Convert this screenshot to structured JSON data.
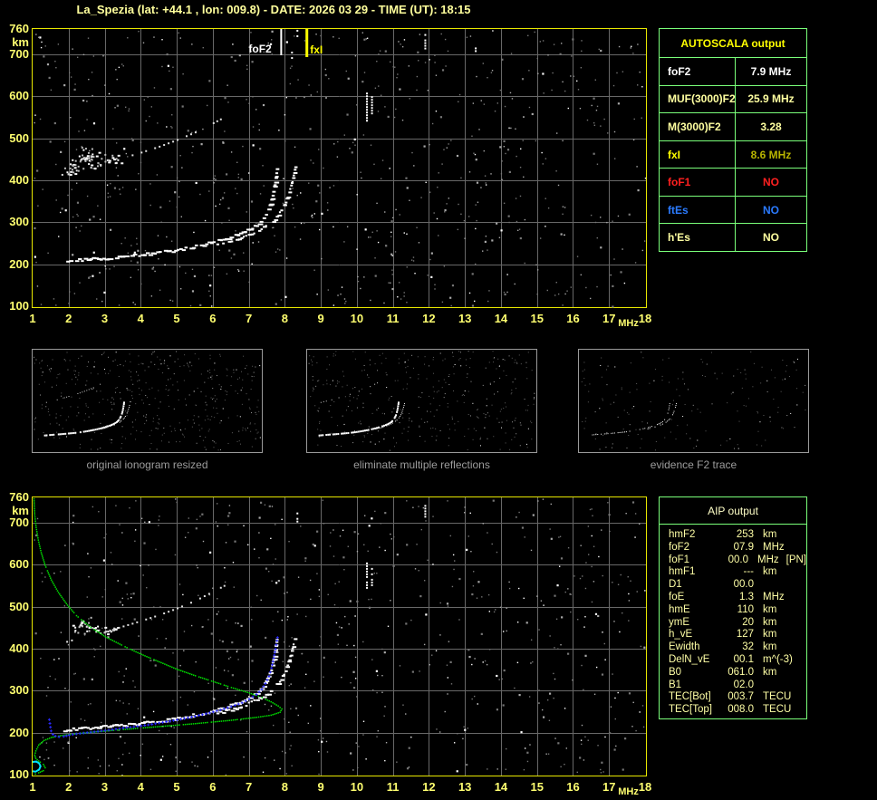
{
  "title": "La_Spezia (lat: +44.1 , lon: 009.8) - DATE: 2026 03 29 - TIME (UT): 18:15",
  "colors": {
    "title": "#ffff9c",
    "axis": "#ffff70",
    "grid": "#686868",
    "border": "#e8e800",
    "table_border": "#7aff7a",
    "trace": "#ffffff",
    "profile": "#00e400",
    "autoscaled": "#2a2aff",
    "e_region": "#00e5ff",
    "marker_foF2": "#ffffff",
    "marker_fxI": "#ffff00"
  },
  "autoscala": {
    "title": "AUTOSCALA output",
    "rows": [
      {
        "label": "foF2",
        "value": "7.9 MHz",
        "label_color": "#ffffff",
        "value_color": "#ffffff"
      },
      {
        "label": "MUF(3000)F2",
        "value": "25.9 MHz",
        "label_color": "#ffffa0",
        "value_color": "#ffffa0"
      },
      {
        "label": "M(3000)F2",
        "value": "3.28",
        "label_color": "#ffffa0",
        "value_color": "#ffffa0"
      },
      {
        "label": "fxI",
        "value": "8.6 MHz",
        "label_color": "#ffff00",
        "value_color": "#b8b400"
      },
      {
        "label": "foF1",
        "value": "NO",
        "label_color": "#ff2020",
        "value_color": "#ff2020"
      },
      {
        "label": "ftEs",
        "value": "NO",
        "label_color": "#2b7bff",
        "value_color": "#2b7bff"
      },
      {
        "label": "h'Es",
        "value": "NO",
        "label_color": "#ffffa0",
        "value_color": "#ffffa0"
      }
    ]
  },
  "aip": {
    "title": "AIP output",
    "rows": [
      {
        "label": "hmF2",
        "value": "253",
        "unit": "km",
        "note": ""
      },
      {
        "label": "foF2",
        "value": "07.9",
        "unit": "MHz",
        "note": ""
      },
      {
        "label": "foF1",
        "value": "00.0",
        "unit": "MHz",
        "note": "[PN]"
      },
      {
        "label": "hmF1",
        "value": "---",
        "unit": "km",
        "note": ""
      },
      {
        "label": "D1",
        "value": "00.0",
        "unit": "",
        "note": ""
      },
      {
        "label": "foE",
        "value": "1.3",
        "unit": "MHz",
        "note": ""
      },
      {
        "label": "hmE",
        "value": "110",
        "unit": "km",
        "note": ""
      },
      {
        "label": "ymE",
        "value": "20",
        "unit": "km",
        "note": ""
      },
      {
        "label": "h_vE",
        "value": "127",
        "unit": "km",
        "note": ""
      },
      {
        "label": "Ewidth",
        "value": "32",
        "unit": "km",
        "note": ""
      },
      {
        "label": "DelN_vE",
        "value": "00.1",
        "unit": "m^(-3)",
        "note": ""
      },
      {
        "label": "B0",
        "value": "061.0",
        "unit": "km",
        "note": ""
      },
      {
        "label": "B1",
        "value": "02.0",
        "unit": "",
        "note": ""
      },
      {
        "label": "TEC[Bot]",
        "value": "003.7",
        "unit": "TECU",
        "note": ""
      },
      {
        "label": "TEC[Top]",
        "value": "008.0",
        "unit": "TECU",
        "note": ""
      }
    ]
  },
  "thumbnails": [
    {
      "caption": "original ionogram resized"
    },
    {
      "caption": "eliminate multiple reflections"
    },
    {
      "caption": "evidence F2 trace"
    }
  ],
  "chart_data": {
    "type": "scatter",
    "description": "ionogram: virtual height (km) vs frequency (MHz), two panels plus three thumbnails",
    "x_axis": {
      "label": "MHz",
      "min": 1,
      "max": 18,
      "ticks": [
        "1",
        "2",
        "3",
        "4",
        "5",
        "6",
        "7",
        "8",
        "9",
        "10",
        "11",
        "12",
        "13",
        "14",
        "15",
        "16",
        "17",
        "18"
      ]
    },
    "y_axis": {
      "label": "km",
      "min": 100,
      "max": 760,
      "ticks": [
        "760",
        "700",
        "600",
        "500",
        "400",
        "300",
        "200",
        "100"
      ]
    },
    "markers": {
      "foF2": {
        "label": "foF2",
        "mhz": 7.9
      },
      "fxI": {
        "label": "fxI",
        "mhz": 8.6
      }
    },
    "trace_o": [
      [
        1.85,
        208
      ],
      [
        2.1,
        210
      ],
      [
        2.5,
        213
      ],
      [
        3.0,
        216
      ],
      [
        3.5,
        220
      ],
      [
        4.0,
        224
      ],
      [
        4.5,
        229
      ],
      [
        5.0,
        236
      ],
      [
        5.5,
        244
      ],
      [
        6.0,
        254
      ],
      [
        6.4,
        264
      ],
      [
        6.8,
        276
      ],
      [
        7.0,
        284
      ],
      [
        7.2,
        295
      ],
      [
        7.35,
        308
      ],
      [
        7.45,
        322
      ],
      [
        7.55,
        340
      ],
      [
        7.62,
        360
      ],
      [
        7.68,
        385
      ],
      [
        7.73,
        412
      ],
      [
        7.76,
        432
      ]
    ],
    "trace_x": [
      [
        6.1,
        248
      ],
      [
        6.5,
        257
      ],
      [
        6.9,
        268
      ],
      [
        7.2,
        279
      ],
      [
        7.45,
        291
      ],
      [
        7.65,
        305
      ],
      [
        7.8,
        320
      ],
      [
        7.95,
        340
      ],
      [
        8.05,
        362
      ],
      [
        8.15,
        388
      ],
      [
        8.22,
        412
      ],
      [
        8.28,
        436
      ]
    ],
    "second_hop": [
      [
        1.8,
        415
      ],
      [
        2.2,
        425
      ],
      [
        2.6,
        432
      ],
      [
        3.0,
        442
      ],
      [
        3.5,
        455
      ],
      [
        4.0,
        468
      ],
      [
        4.5,
        482
      ],
      [
        5.0,
        498
      ],
      [
        5.5,
        516
      ],
      [
        6.0,
        538
      ],
      [
        6.4,
        556
      ]
    ],
    "profile_green": [
      [
        1.02,
        758
      ],
      [
        1.04,
        720
      ],
      [
        1.08,
        690
      ],
      [
        1.14,
        660
      ],
      [
        1.22,
        630
      ],
      [
        1.33,
        600
      ],
      [
        1.5,
        565
      ],
      [
        1.7,
        535
      ],
      [
        1.95,
        505
      ],
      [
        2.2,
        480
      ],
      [
        2.6,
        452
      ],
      [
        3.0,
        430
      ],
      [
        3.5,
        408
      ],
      [
        4.0,
        388
      ],
      [
        4.5,
        370
      ],
      [
        5.0,
        352
      ],
      [
        5.5,
        337
      ],
      [
        6.0,
        323
      ],
      [
        6.5,
        309
      ],
      [
        7.0,
        296
      ],
      [
        7.35,
        285
      ],
      [
        7.6,
        275
      ],
      [
        7.8,
        265
      ],
      [
        7.9,
        258
      ],
      [
        7.85,
        250
      ],
      [
        7.6,
        243
      ],
      [
        7.2,
        238
      ],
      [
        6.5,
        231
      ],
      [
        5.5,
        223
      ],
      [
        4.5,
        216
      ],
      [
        3.5,
        209
      ],
      [
        2.8,
        204
      ],
      [
        2.2,
        199
      ],
      [
        1.8,
        195
      ],
      [
        1.5,
        190
      ],
      [
        1.3,
        183
      ],
      [
        1.15,
        172
      ],
      [
        1.07,
        158
      ],
      [
        1.04,
        148
      ],
      [
        1.07,
        140
      ],
      [
        1.15,
        134
      ],
      [
        1.28,
        126
      ],
      [
        1.33,
        118
      ],
      [
        1.28,
        111
      ],
      [
        1.15,
        106
      ],
      [
        1.06,
        103
      ],
      [
        1.02,
        100
      ]
    ],
    "autoscaled_trace_blue": [
      [
        1.45,
        232
      ],
      [
        1.5,
        205
      ],
      [
        1.55,
        197
      ],
      [
        1.62,
        193
      ],
      [
        1.72,
        191
      ],
      [
        1.85,
        192
      ],
      [
        2.0,
        195
      ],
      [
        2.2,
        198
      ],
      [
        2.5,
        201
      ],
      [
        2.8,
        204
      ],
      [
        3.1,
        207
      ],
      [
        3.5,
        212
      ],
      [
        3.9,
        216
      ],
      [
        4.3,
        221
      ],
      [
        4.7,
        227
      ],
      [
        5.1,
        233
      ],
      [
        5.5,
        240
      ],
      [
        5.9,
        248
      ],
      [
        6.2,
        255
      ],
      [
        6.5,
        263
      ],
      [
        6.8,
        272
      ],
      [
        7.0,
        281
      ],
      [
        7.2,
        292
      ],
      [
        7.35,
        304
      ],
      [
        7.45,
        318
      ],
      [
        7.55,
        335
      ],
      [
        7.62,
        355
      ],
      [
        7.68,
        378
      ],
      [
        7.73,
        400
      ],
      [
        7.77,
        420
      ],
      [
        7.8,
        435
      ]
    ],
    "e_region_cyan": [
      [
        1.0,
        130
      ],
      [
        1.1,
        131
      ],
      [
        1.18,
        127
      ],
      [
        1.22,
        120
      ],
      [
        1.18,
        112
      ],
      [
        1.08,
        107
      ],
      [
        1.0,
        108
      ]
    ],
    "streaks_top": [
      {
        "f": 10.28,
        "km1": 540,
        "km2": 615
      },
      {
        "f": 10.42,
        "km1": 555,
        "km2": 600
      },
      {
        "f": 8.35,
        "km1": 735,
        "km2": 758
      },
      {
        "f": 11.9,
        "km1": 712,
        "km2": 748
      },
      {
        "f": 13.3,
        "km1": 700,
        "km2": 716
      },
      {
        "f": 8.2,
        "km1": 688,
        "km2": 706
      }
    ],
    "streaks_bottom": [
      {
        "f": 10.28,
        "km1": 530,
        "km2": 605
      },
      {
        "f": 10.42,
        "km1": 548,
        "km2": 592
      },
      {
        "f": 8.35,
        "km1": 700,
        "km2": 724
      },
      {
        "f": 11.9,
        "km1": 715,
        "km2": 742
      }
    ],
    "clusters_top": [
      {
        "f": 2.5,
        "km": 455,
        "n": 42,
        "df": 0.55,
        "dkm": 28
      },
      {
        "f": 2.1,
        "km": 430,
        "n": 16,
        "df": 0.35,
        "dkm": 20
      },
      {
        "f": 3.2,
        "km": 448,
        "n": 14,
        "df": 0.3,
        "dkm": 18
      }
    ],
    "clusters_bottom": [
      {
        "f": 2.5,
        "km": 455,
        "n": 34,
        "df": 0.5,
        "dkm": 26
      },
      {
        "f": 3.1,
        "km": 445,
        "n": 12,
        "df": 0.3,
        "dkm": 16
      }
    ],
    "noise": {
      "top": {
        "seed": 7,
        "count": 760
      },
      "bottom": {
        "seed": 11,
        "count": 700
      },
      "thumb1": {
        "seed": 21,
        "count": 430
      },
      "thumb2": {
        "seed": 22,
        "count": 360
      },
      "thumb3": {
        "seed": 23,
        "count": 175
      }
    }
  }
}
